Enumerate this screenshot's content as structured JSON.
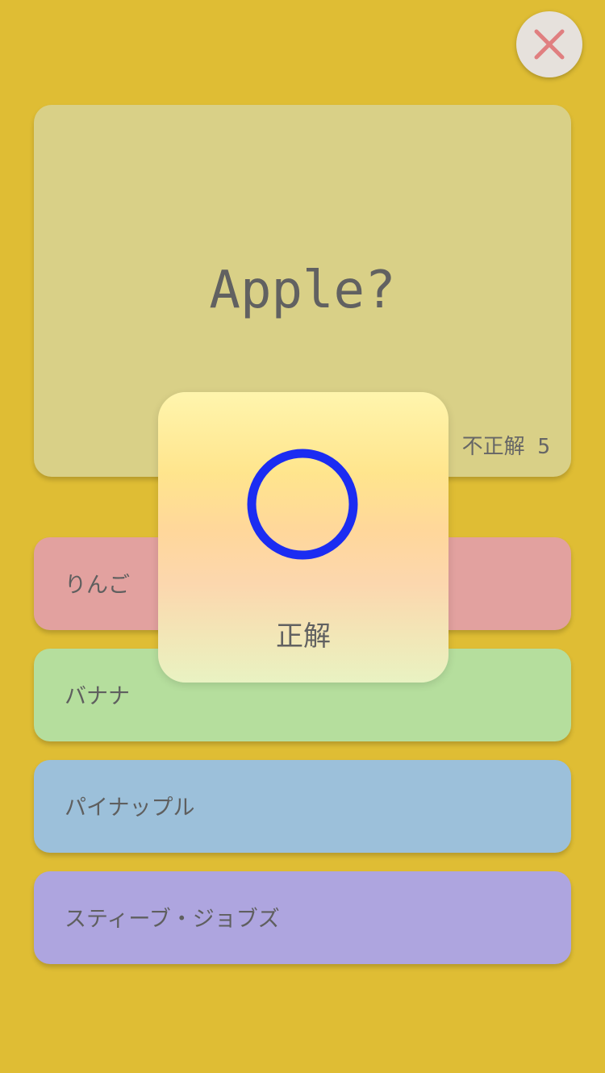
{
  "header": {
    "close_icon": "close-x-icon",
    "close_icon_color": "#e07f80"
  },
  "question": {
    "text": "Apple?",
    "score_text": "3 不正解 5"
  },
  "answers": [
    {
      "label": "りんご",
      "color": "#e2a19f"
    },
    {
      "label": "バナナ",
      "color": "#b5de9d"
    },
    {
      "label": "パイナップル",
      "color": "#9cc0da"
    },
    {
      "label": "スティーブ・ジョブズ",
      "color": "#aea5df"
    }
  ],
  "result": {
    "icon": "correct-circle-icon",
    "icon_color": "#1b2cf2",
    "label": "正解"
  },
  "colors": {
    "background": "#dfbd34",
    "question_card": "#d9d087"
  }
}
